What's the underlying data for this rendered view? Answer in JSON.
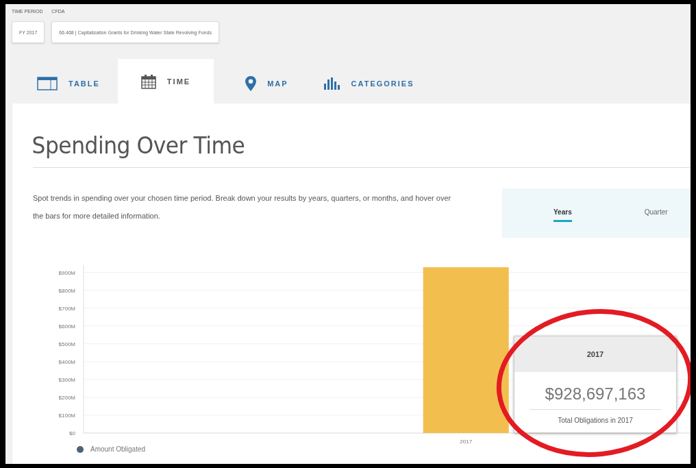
{
  "filters": [
    {
      "label": "TIME PERIOD",
      "value": "FY 2017"
    },
    {
      "label": "CFDA",
      "value": "66.468 | Capitalization Grants for Drinking Water State Revolving Funds"
    }
  ],
  "tabs": [
    {
      "label": "TABLE",
      "kind": "table",
      "selected": false
    },
    {
      "label": "TIME",
      "kind": "calendar",
      "selected": true
    },
    {
      "label": "MAP",
      "kind": "pin",
      "selected": false
    },
    {
      "label": "CATEGORIES",
      "kind": "bars",
      "selected": false
    }
  ],
  "section": {
    "title": "Spending Over Time",
    "description": "Spot trends in spending over your chosen time period. Break down your results by years, quarters, or months, and hover over the bars for more detailed information.",
    "periods": [
      {
        "label": "Years",
        "selected": true
      },
      {
        "label": "Quarter",
        "selected": false
      }
    ]
  },
  "chart": {
    "chart_data": {
      "type": "bar",
      "categories": [
        "2017"
      ],
      "series": [
        {
          "name": "Amount Obligated",
          "color": "#f2bf4f",
          "values": [
            929
          ]
        }
      ],
      "ylim": [
        0,
        929
      ],
      "grid": true,
      "yticks": [
        {
          "value": 0,
          "label": "$0"
        },
        {
          "value": 100,
          "label": "$100M"
        },
        {
          "value": 200,
          "label": "$200M"
        },
        {
          "value": 300,
          "label": "$300M"
        },
        {
          "value": 400,
          "label": "$400M"
        },
        {
          "value": 500,
          "label": "$500M"
        },
        {
          "value": 600,
          "label": "$600M"
        },
        {
          "value": 700,
          "label": "$700M"
        },
        {
          "value": 800,
          "label": "$800M"
        },
        {
          "value": 900,
          "label": "$900M"
        }
      ]
    },
    "tooltip": {
      "title": "2017",
      "value": "$928,697,163",
      "label": "Total Obligations in 2017"
    }
  }
}
